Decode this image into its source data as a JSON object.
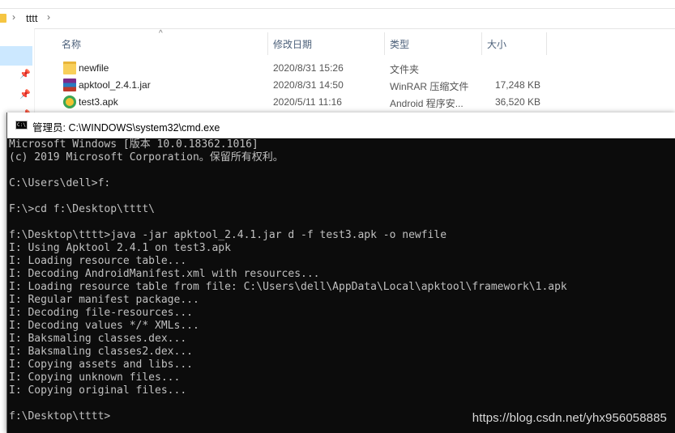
{
  "explorer": {
    "breadcrumb": [
      "tttt"
    ],
    "columns": {
      "name": "名称",
      "date": "修改日期",
      "type": "类型",
      "size": "大小"
    },
    "files": [
      {
        "name": "newfile",
        "date": "2020/8/31 15:26",
        "type": "文件夹",
        "size": "",
        "icon": "folder-icon"
      },
      {
        "name": "apktool_2.4.1.jar",
        "date": "2020/8/31 14:50",
        "type": "WinRAR 压缩文件",
        "size": "17,248 KB",
        "icon": "winrar-archive-icon"
      },
      {
        "name": "test3.apk",
        "date": "2020/5/11 11:16",
        "type": "Android 程序安...",
        "size": "36,520 KB",
        "icon": "apk-file-icon"
      }
    ]
  },
  "cmd": {
    "title": "管理员: C:\\WINDOWS\\system32\\cmd.exe",
    "lines": [
      "Microsoft Windows [版本 10.0.18362.1016]",
      "(c) 2019 Microsoft Corporation。保留所有权利。",
      "",
      "C:\\Users\\dell>f:",
      "",
      "F:\\>cd f:\\Desktop\\tttt\\",
      "",
      "f:\\Desktop\\tttt>java -jar apktool_2.4.1.jar d -f test3.apk -o newfile",
      "I: Using Apktool 2.4.1 on test3.apk",
      "I: Loading resource table...",
      "I: Decoding AndroidManifest.xml with resources...",
      "I: Loading resource table from file: C:\\Users\\dell\\AppData\\Local\\apktool\\framework\\1.apk",
      "I: Regular manifest package...",
      "I: Decoding file-resources...",
      "I: Decoding values */* XMLs...",
      "I: Baksmaling classes.dex...",
      "I: Baksmaling classes2.dex...",
      "I: Copying assets and libs...",
      "I: Copying unknown files...",
      "I: Copying original files...",
      "",
      "f:\\Desktop\\tttt>"
    ]
  },
  "watermark": "https://blog.csdn.net/yhx956058885"
}
